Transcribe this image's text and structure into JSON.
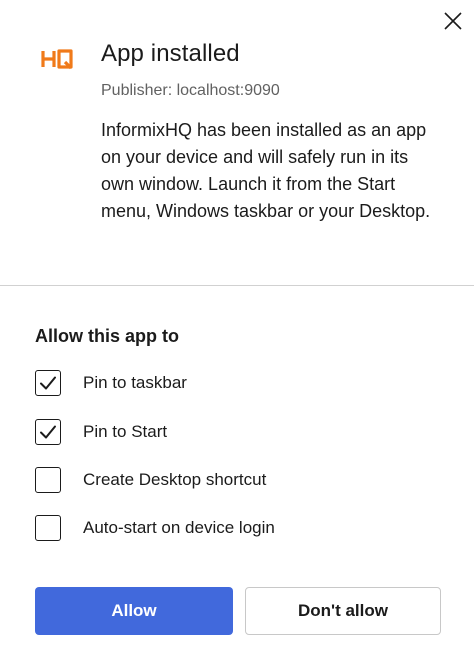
{
  "app": {
    "logo_text": "HQ",
    "title": "App installed",
    "publisher": "Publisher: localhost:9090",
    "description": "InformixHQ has been installed as an app on your device and will safely run in its own window. Launch it from the Start menu, Windows taskbar or your Desktop."
  },
  "permissions": {
    "heading": "Allow this app to",
    "options": [
      {
        "label": "Pin to taskbar",
        "checked": true
      },
      {
        "label": "Pin to Start",
        "checked": true
      },
      {
        "label": "Create Desktop shortcut",
        "checked": false
      },
      {
        "label": "Auto-start on device login",
        "checked": false
      }
    ]
  },
  "actions": {
    "allow_label": "Allow",
    "deny_label": "Don't allow"
  },
  "colors": {
    "accent": "#4169dc",
    "logo": "#f07a1a"
  },
  "icons": {
    "close": "close-icon",
    "check": "checkmark-icon"
  }
}
